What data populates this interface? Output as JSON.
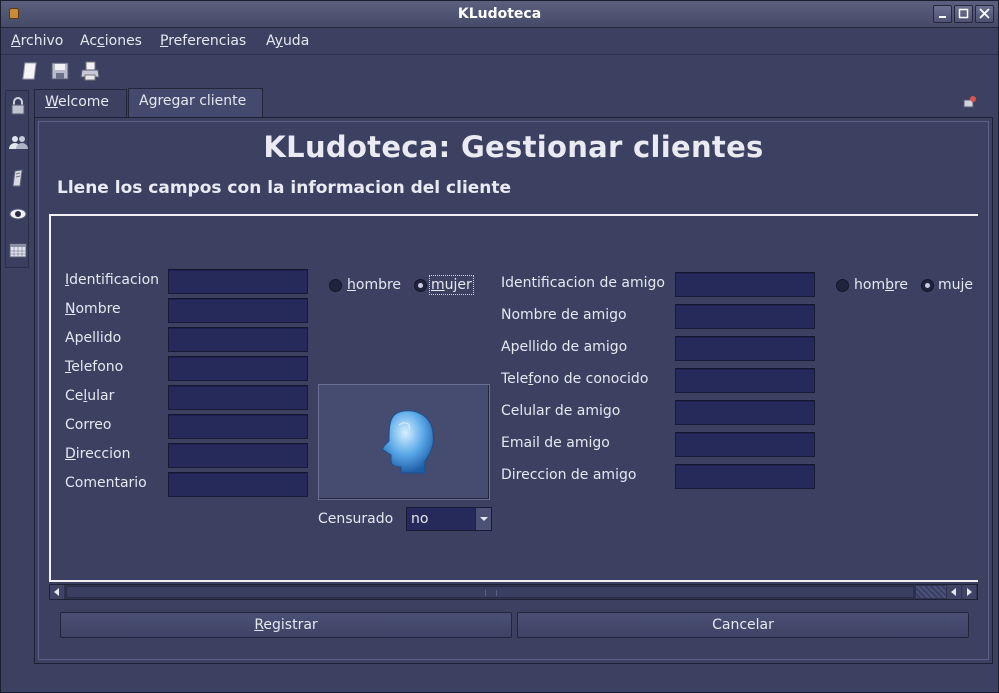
{
  "window": {
    "title": "KLudoteca"
  },
  "menu": {
    "archivo_pre": "",
    "archivo_key": "A",
    "archivo_post": "rchivo",
    "acciones_pre": "Ac",
    "acciones_key": "c",
    "acciones_post": "iones",
    "preferencias_pre": "",
    "preferencias_key": "P",
    "preferencias_post": "referencias",
    "ayuda_pre": "A",
    "ayuda_key": "y",
    "ayuda_post": "uda"
  },
  "toolbar": {
    "icons": [
      "new-document-icon",
      "save-icon",
      "print-icon"
    ]
  },
  "sidebar": {
    "icons": [
      "lock-icon",
      "users-icon",
      "note-icon",
      "eye-icon",
      "calendar-icon"
    ]
  },
  "tabs": [
    {
      "pre": "",
      "key": "W",
      "post": "elcome"
    },
    {
      "label": "Agregar cliente"
    }
  ],
  "page": {
    "title": "KLudoteca: Gestionar clientes",
    "subtitle": "Llene los campos con la informacion del cliente"
  },
  "client": {
    "identificacion": {
      "pre": "",
      "key": "I",
      "post": "dentificacion",
      "value": ""
    },
    "nombre": {
      "pre": "",
      "key": "N",
      "post": "ombre",
      "value": ""
    },
    "apellido": {
      "label": "Apellido",
      "value": ""
    },
    "telefono": {
      "pre": "",
      "key": "T",
      "post": "elefono",
      "value": ""
    },
    "celular": {
      "pre": "Ce",
      "key": "l",
      "post": "ular",
      "value": ""
    },
    "correo": {
      "label": "Correo",
      "value": ""
    },
    "direccion": {
      "pre": "",
      "key": "D",
      "post": "ireccion",
      "value": ""
    },
    "comentario": {
      "label": "Comentario",
      "value": ""
    },
    "gender": {
      "hombre_pre": "",
      "hombre_key": "h",
      "hombre_post": "ombre",
      "mujer_pre": "",
      "mujer_key": "m",
      "mujer_post": "ujer",
      "selected": "mujer"
    },
    "censurado": {
      "label": "Censurado",
      "value": "no"
    }
  },
  "friend": {
    "identificacion": {
      "label": "Identificacion de amigo",
      "value": ""
    },
    "nombre": {
      "label": "Nombre de amigo",
      "value": ""
    },
    "apellido": {
      "label": "Apellido de amigo",
      "value": ""
    },
    "telefono": {
      "pre": "Tele",
      "key": "f",
      "post": "ono de conocido",
      "value": ""
    },
    "celular": {
      "label": "Celular de amigo",
      "value": ""
    },
    "email": {
      "label": "Email de amigo",
      "value": ""
    },
    "direccion": {
      "label": "Direccion de amigo",
      "value": ""
    },
    "gender": {
      "hombre_pre": "hom",
      "hombre_key": "b",
      "hombre_post": "re",
      "mujer_label": "muje",
      "selected": "mujer"
    }
  },
  "buttons": {
    "registrar_pre": "",
    "registrar_key": "R",
    "registrar_post": "egistrar",
    "cancelar": "Cancelar"
  },
  "colors": {
    "background": "#3c4162",
    "field": "#262a5a",
    "head_icon": "#5aa8e8"
  }
}
